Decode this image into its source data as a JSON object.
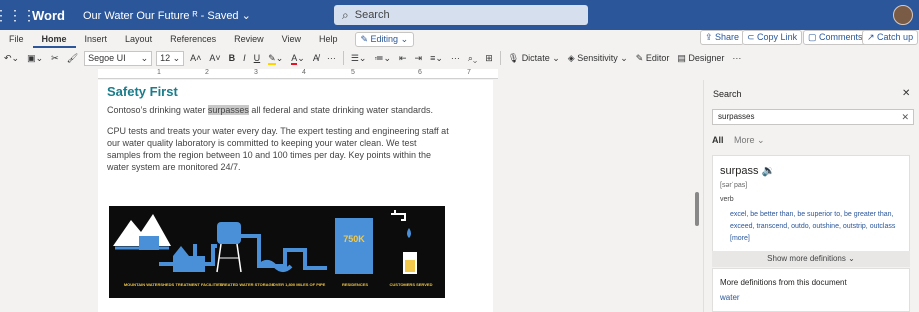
{
  "titlebar": {
    "app_name": "Word",
    "doc_name": "Our Water Our Future",
    "doc_status": "Saved",
    "search_placeholder": "Search"
  },
  "ribbon": {
    "tabs": [
      "File",
      "Home",
      "Insert",
      "Layout",
      "References",
      "Review",
      "View",
      "Help"
    ],
    "active_tab": "Home",
    "editing_mode": "Editing",
    "actions": {
      "share": "Share",
      "copy_link": "Copy Link",
      "comments": "Comments",
      "catch_up": "Catch up"
    },
    "font_name": "Segoe UI",
    "font_size": "12",
    "dictate": "Dictate",
    "sensitivity": "Sensitivity",
    "editor": "Editor",
    "designer": "Designer"
  },
  "ruler": [
    "1",
    "2",
    "3",
    "4",
    "5",
    "6",
    "7"
  ],
  "document": {
    "heading": "Safety First",
    "para1_before": "Contoso’s drinking water ",
    "para1_highlight": "surpasses",
    "para1_after": " all federal and state drinking water standards.",
    "para2": "CPU tests and treats your water every day. The expert testing and engineering staff at our water quality laboratory is committed to keeping your water clean. We test samples from the region between 10 and 100 times per day. Key points within the water system are monitored 24/7.",
    "infographic": {
      "tank_label": "750K",
      "captions": [
        "MOUNTAIN WATERSHEDS",
        "TREATMENT FACILITIES",
        "TREATED WATER STORAGE",
        "OVER 1,800 MILES OF PIPE",
        "RESIDENCES",
        "CUSTOMERS SERVED"
      ]
    }
  },
  "search_panel": {
    "title": "Search",
    "query": "surpasses",
    "filters": {
      "all": "All",
      "more": "More"
    },
    "definition": {
      "word": "surpass",
      "pronunciation": "[sərˈpas]",
      "part_of_speech": "verb",
      "synonyms": "excel,  be better than,  be superior to,  be greater than,  exceed,  transcend,  outdo,  outshine,  outstrip,  outclass  [more]"
    },
    "show_more": "Show more definitions",
    "more_title": "More definitions from this document",
    "more_link": "water"
  },
  "colors": {
    "brand": "#2b579a",
    "heading": "#1b7c8a",
    "infographic_blue": "#4a90d9",
    "infographic_yellow": "#f2c94c"
  }
}
